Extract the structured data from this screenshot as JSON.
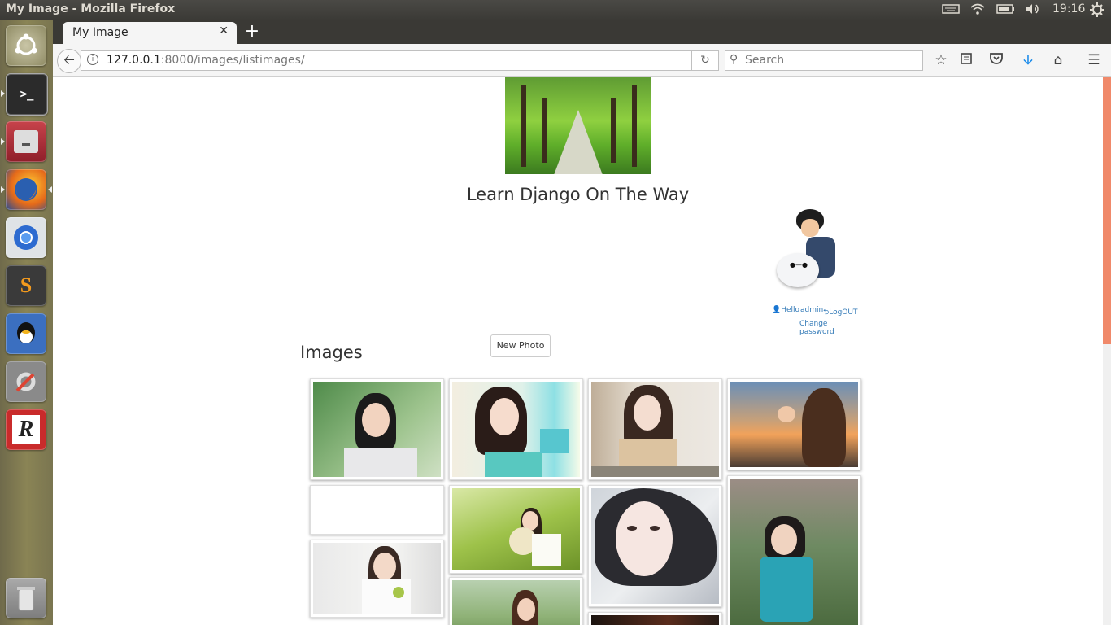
{
  "desktop": {
    "window_title": "My Image - Mozilla Firefox",
    "clock": "19:16",
    "tray_icons": [
      "keyboard-icon",
      "wifi-icon",
      "battery-icon",
      "volume-icon",
      "gear-icon"
    ]
  },
  "launcher": {
    "items": [
      "ubuntu-dash",
      "terminal",
      "file-cabinet",
      "firefox",
      "chromium",
      "sublime-text",
      "qq",
      "system-settings",
      "r-studio",
      "trash"
    ]
  },
  "browser": {
    "tab_title": "My Image",
    "url_host": "127.0.0.1",
    "url_path": ":8000/images/listimages/",
    "search_placeholder": "Search"
  },
  "page": {
    "site_title": "Learn Django On The Way",
    "user": {
      "hello": "Hello",
      "username": "admin",
      "logout": "LogOUT",
      "change_password": "Change password"
    },
    "images_heading": "Images",
    "new_photo_label": "New Photo"
  },
  "colors": {
    "link": "#337ab7",
    "scroll_thumb": "#f0896a",
    "ubuntu_panel": "#3b3a36"
  }
}
